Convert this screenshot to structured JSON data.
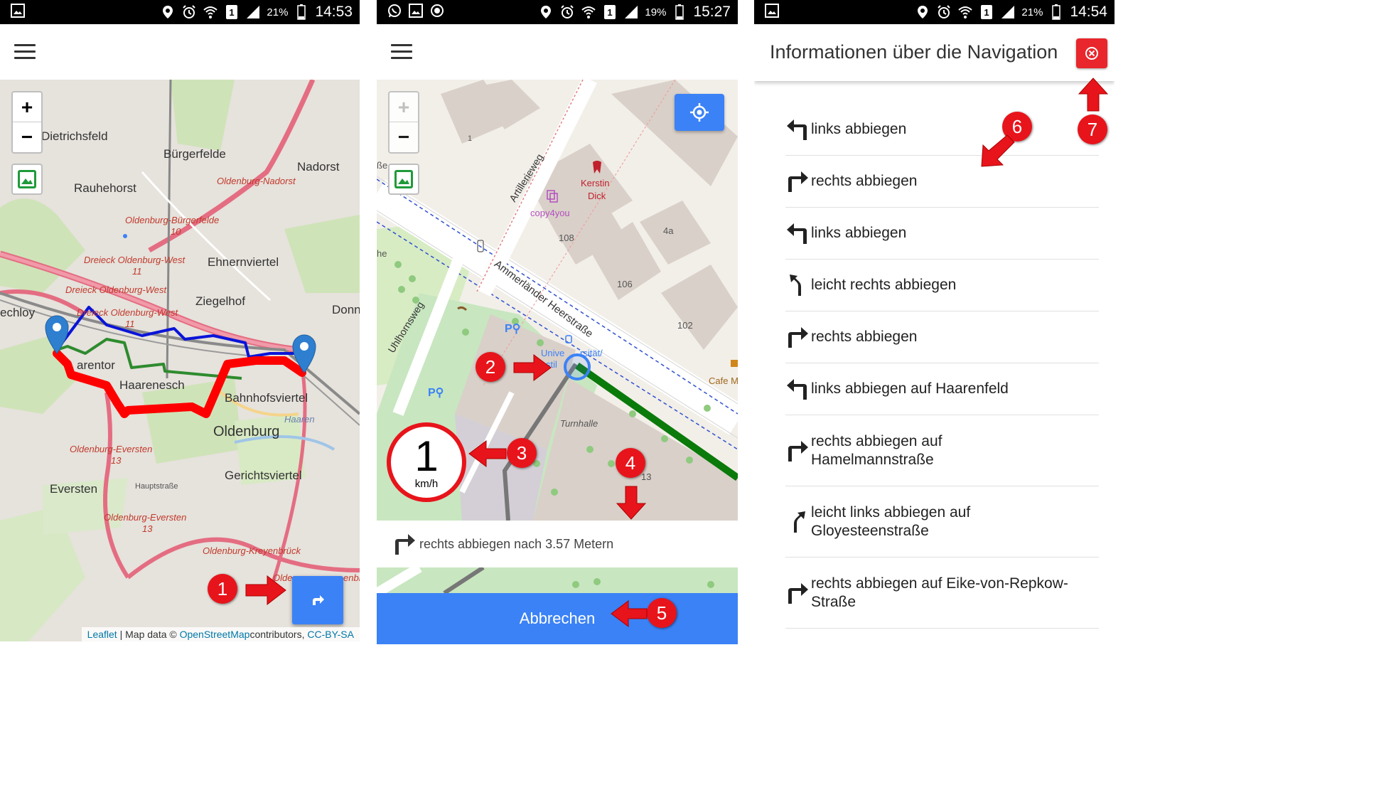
{
  "screens": [
    {
      "status": {
        "battery": "21%",
        "time": "14:53",
        "sim": "1"
      },
      "map": {
        "labels": [
          "Dietrichsfeld",
          "Bürgerfelde",
          "Nadorst",
          "Rauhehorst",
          "Ehnernviertel",
          "Ziegelhof",
          "Donn",
          "echloy",
          "arentor",
          "Haarenesch",
          "Bahnhofsviertel",
          "Oldenburg",
          "Gerichtsviertel",
          "Eversten"
        ],
        "road_labels": [
          "Oldenburg-Nadorst",
          "Oldenburg-Bürgerfelde",
          "10",
          "Dreieck Oldenburg-West",
          "11",
          "Dreieck Oldenburg-West",
          "Dreieck Oldenburg-West",
          "11",
          "Oldenburg-Eversten",
          "13",
          "Oldenburg-Eversten",
          "13",
          "Oldenburg-Kreyenbrück",
          "Hauptstraße",
          "Olden",
          "enbr"
        ],
        "water_label": "Haaren",
        "zoom_in": "+",
        "zoom_out": "−",
        "route_colors": {
          "fast": "#ff0000",
          "medium": "#2e8b2e",
          "slow": "#0010d0"
        }
      },
      "attribution": {
        "leaflet": "Leaflet",
        "sep": " | Map data © ",
        "osm": "OpenStreetMap",
        "contrib": "contributors, ",
        "license": "CC-BY-SA"
      },
      "badge": "1"
    },
    {
      "status": {
        "battery": "19%",
        "time": "15:27",
        "sim": "1"
      },
      "map": {
        "street_labels": [
          "Artillerieweg",
          "Ammerländer Heerstraße",
          "Uhlhornsweg",
          "Turnhalle"
        ],
        "house_numbers": [
          "1",
          "108",
          "4a",
          "106",
          "102",
          "13"
        ],
        "poi_labels": [
          "Kerstin",
          "Dick",
          "copy4you",
          "Unive",
          "stil",
          "rsität/",
          "Cafe M"
        ],
        "edge_labels": [
          "ße",
          "he"
        ],
        "zoom_in": "+",
        "zoom_out": "−"
      },
      "speed": {
        "value": "1",
        "unit": "km/h"
      },
      "instruction": "rechts abbiegen nach 3.57 Metern",
      "cancel_label": "Abbrechen",
      "badges": [
        "2",
        "3",
        "4",
        "5"
      ]
    },
    {
      "status": {
        "battery": "21%",
        "time": "14:54",
        "sim": "1"
      },
      "title": "Informationen über die Navigation",
      "steps": [
        {
          "icon": "turn-left-icon",
          "text": "links abbiegen"
        },
        {
          "icon": "turn-right-icon",
          "text": "rechts abbiegen"
        },
        {
          "icon": "turn-left-icon",
          "text": "links abbiegen"
        },
        {
          "icon": "slight-right-icon",
          "text": "leicht rechts abbiegen"
        },
        {
          "icon": "turn-right-icon",
          "text": "rechts abbiegen"
        },
        {
          "icon": "turn-left-icon",
          "text": "links abbiegen auf Haarenfeld"
        },
        {
          "icon": "turn-right-icon",
          "text": "rechts abbiegen auf\nHamelmannstraße"
        },
        {
          "icon": "slight-left-icon",
          "text": "leicht links abbiegen auf\nGloyesteenstraße"
        },
        {
          "icon": "turn-right-icon",
          "text": "rechts abbiegen auf Eike-von-Repkow-\nStraße"
        }
      ],
      "badges": [
        "6",
        "7"
      ]
    }
  ],
  "colors": {
    "accent": "#3b82f6",
    "annotation_red": "#e8141b",
    "statusbar": "#000000"
  }
}
